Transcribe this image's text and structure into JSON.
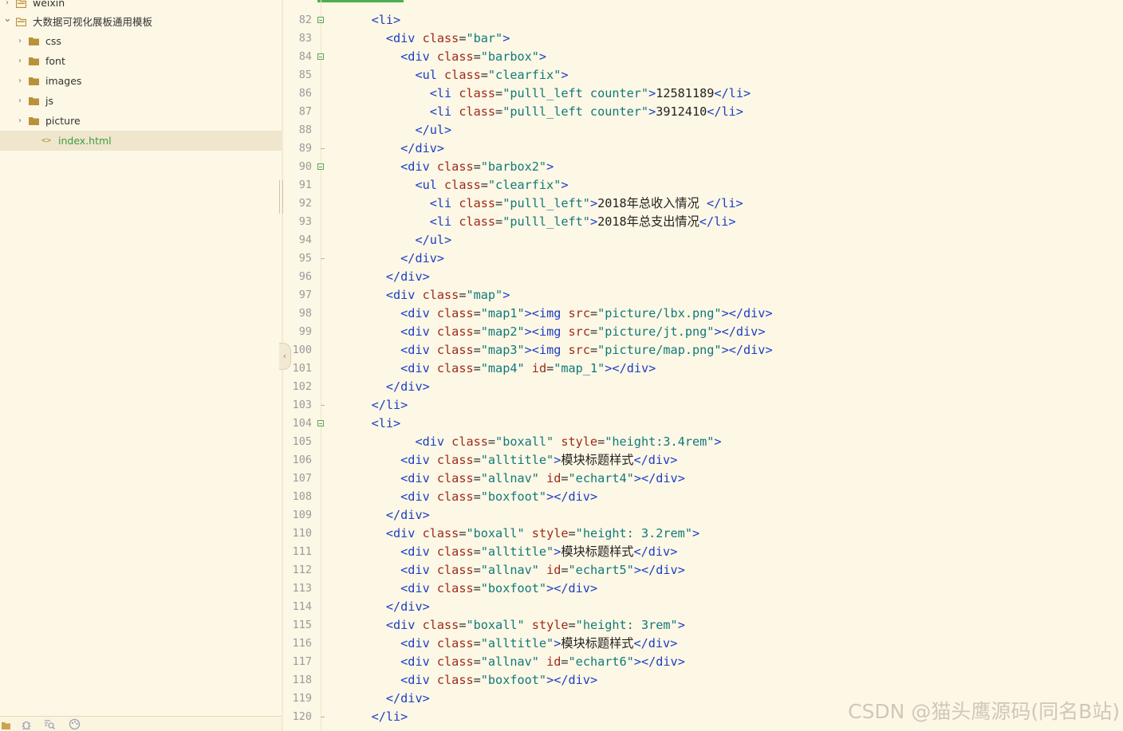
{
  "sidebar": {
    "items": [
      {
        "label": "weixin",
        "kind": "folder",
        "expanded": false,
        "selected": false
      },
      {
        "label": "大数据可视化展板通用模板",
        "kind": "folder",
        "expanded": true,
        "selected": false
      },
      {
        "label": "css",
        "kind": "folder",
        "expanded": false,
        "selected": false
      },
      {
        "label": "font",
        "kind": "folder",
        "expanded": false,
        "selected": false
      },
      {
        "label": "images",
        "kind": "folder",
        "expanded": false,
        "selected": false
      },
      {
        "label": "js",
        "kind": "folder",
        "expanded": false,
        "selected": false
      },
      {
        "label": "picture",
        "kind": "folder",
        "expanded": false,
        "selected": false
      },
      {
        "label": "index.html",
        "kind": "file",
        "selected": true
      }
    ],
    "bottom_icons": [
      "project-icon",
      "bug-icon",
      "search-file-icon",
      "palette-icon"
    ]
  },
  "editor": {
    "lines": [
      {
        "n": "82",
        "fold": "open",
        "code": "    <li>"
      },
      {
        "n": "83",
        "fold": "",
        "code": "      <div class=\"bar\">"
      },
      {
        "n": "84",
        "fold": "open",
        "code": "        <div class=\"barbox\">"
      },
      {
        "n": "85",
        "fold": "",
        "code": "          <ul class=\"clearfix\">"
      },
      {
        "n": "86",
        "fold": "",
        "code": "            <li class=\"pulll_left counter\">12581189</li>"
      },
      {
        "n": "87",
        "fold": "",
        "code": "            <li class=\"pulll_left counter\">3912410</li>"
      },
      {
        "n": "88",
        "fold": "",
        "code": "          </ul>"
      },
      {
        "n": "89",
        "fold": "end",
        "code": "        </div>"
      },
      {
        "n": "90",
        "fold": "open",
        "code": "        <div class=\"barbox2\">"
      },
      {
        "n": "91",
        "fold": "",
        "code": "          <ul class=\"clearfix\">"
      },
      {
        "n": "92",
        "fold": "",
        "code": "            <li class=\"pulll_left\">2018年总收入情况 </li>"
      },
      {
        "n": "93",
        "fold": "",
        "code": "            <li class=\"pulll_left\">2018年总支出情况</li>"
      },
      {
        "n": "94",
        "fold": "",
        "code": "          </ul>"
      },
      {
        "n": "95",
        "fold": "end",
        "code": "        </div>"
      },
      {
        "n": "96",
        "fold": "",
        "code": "      </div>"
      },
      {
        "n": "97",
        "fold": "",
        "code": "      <div class=\"map\">"
      },
      {
        "n": "98",
        "fold": "",
        "code": "        <div class=\"map1\"><img src=\"picture/lbx.png\"></div>"
      },
      {
        "n": "99",
        "fold": "",
        "code": "        <div class=\"map2\"><img src=\"picture/jt.png\"></div>"
      },
      {
        "n": "100",
        "fold": "",
        "code": "        <div class=\"map3\"><img src=\"picture/map.png\"></div>"
      },
      {
        "n": "101",
        "fold": "",
        "code": "        <div class=\"map4\" id=\"map_1\"></div>"
      },
      {
        "n": "102",
        "fold": "",
        "code": "      </div>"
      },
      {
        "n": "103",
        "fold": "end",
        "code": "    </li>"
      },
      {
        "n": "104",
        "fold": "open",
        "code": "    <li>"
      },
      {
        "n": "105",
        "fold": "",
        "code": "          <div class=\"boxall\" style=\"height:3.4rem\">"
      },
      {
        "n": "106",
        "fold": "",
        "code": "        <div class=\"alltitle\">模块标题样式</div>"
      },
      {
        "n": "107",
        "fold": "",
        "code": "        <div class=\"allnav\" id=\"echart4\"></div>"
      },
      {
        "n": "108",
        "fold": "",
        "code": "        <div class=\"boxfoot\"></div>"
      },
      {
        "n": "109",
        "fold": "",
        "code": "      </div>"
      },
      {
        "n": "110",
        "fold": "",
        "code": "      <div class=\"boxall\" style=\"height: 3.2rem\">"
      },
      {
        "n": "111",
        "fold": "",
        "code": "        <div class=\"alltitle\">模块标题样式</div>"
      },
      {
        "n": "112",
        "fold": "",
        "code": "        <div class=\"allnav\" id=\"echart5\"></div>"
      },
      {
        "n": "113",
        "fold": "",
        "code": "        <div class=\"boxfoot\"></div>"
      },
      {
        "n": "114",
        "fold": "",
        "code": "      </div>"
      },
      {
        "n": "115",
        "fold": "",
        "code": "      <div class=\"boxall\" style=\"height: 3rem\">"
      },
      {
        "n": "116",
        "fold": "",
        "code": "        <div class=\"alltitle\">模块标题样式</div>"
      },
      {
        "n": "117",
        "fold": "",
        "code": "        <div class=\"allnav\" id=\"echart6\"></div>"
      },
      {
        "n": "118",
        "fold": "",
        "code": "        <div class=\"boxfoot\"></div>"
      },
      {
        "n": "119",
        "fold": "",
        "code": "      </div>"
      },
      {
        "n": "120",
        "fold": "end",
        "code": "    </li>"
      }
    ]
  },
  "watermark": "CSDN @猫头鹰源码(同名B站)",
  "colors": {
    "background": "#fdf7e5",
    "tag": "#1a3fc4",
    "attr": "#9d2a1a",
    "value": "#0f7a7a",
    "accent": "#4caf50"
  }
}
